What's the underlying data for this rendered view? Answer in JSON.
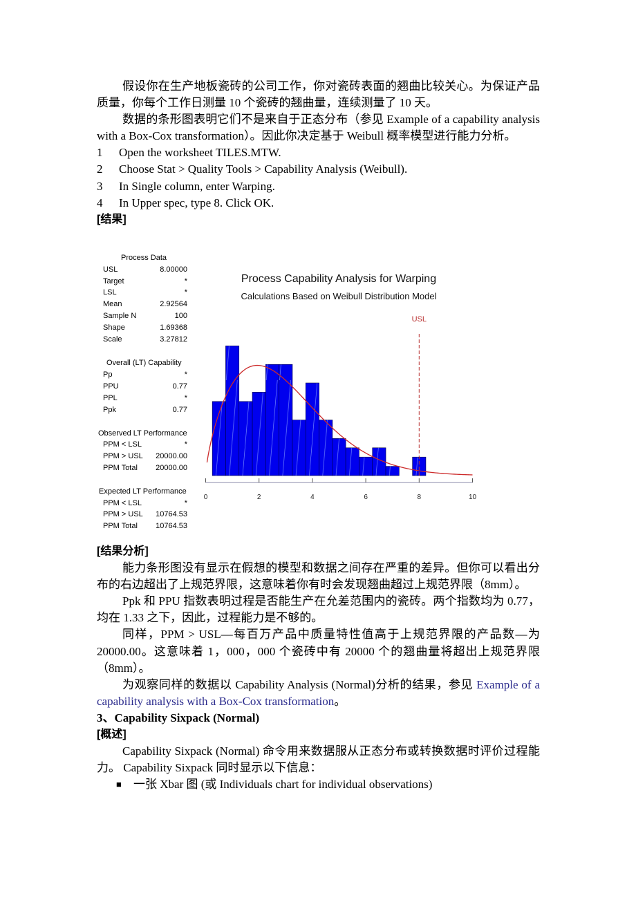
{
  "intro": {
    "p1": "假设你在生产地板瓷砖的公司工作，你对瓷砖表面的翘曲比较关心。为保证产品质量，你每个工作日测量 10 个瓷砖的翘曲量，连续测量了 10 天。",
    "p2": "数据的条形图表明它们不是来自于正态分布（参见 Example of a capability analysis with a Box-Cox transformation）。因此你决定基于 Weibull  概率模型进行能力分析。",
    "steps": [
      {
        "num": "1",
        "text": "Open the worksheet TILES.MTW."
      },
      {
        "num": "2",
        "text": "Choose Stat > Quality Tools > Capability Analysis (Weibull)."
      },
      {
        "num": "3",
        "text": "In Single column, enter Warping."
      },
      {
        "num": "4",
        "text": "In Upper spec, type 8. Click OK."
      }
    ],
    "results_heading": "[结果]"
  },
  "stats_panel": {
    "process_data": {
      "title": "Process Data",
      "rows": [
        {
          "label": "USL",
          "value": "8.00000"
        },
        {
          "label": "Target",
          "value": "*"
        },
        {
          "label": "LSL",
          "value": "*"
        },
        {
          "label": "Mean",
          "value": "2.92564"
        },
        {
          "label": "Sample N",
          "value": "100"
        },
        {
          "label": "Shape",
          "value": "1.69368"
        },
        {
          "label": "Scale",
          "value": "3.27812"
        }
      ]
    },
    "overall_capability": {
      "title": "Overall (LT) Capability",
      "rows": [
        {
          "label": "Pp",
          "value": "*"
        },
        {
          "label": "PPU",
          "value": "0.77"
        },
        {
          "label": "PPL",
          "value": "*"
        },
        {
          "label": "Ppk",
          "value": "0.77"
        }
      ]
    },
    "observed_performance": {
      "title": "Observed LT Performance",
      "rows": [
        {
          "label": "PPM < LSL",
          "value": "*"
        },
        {
          "label": "PPM > USL",
          "value": "20000.00"
        },
        {
          "label": "PPM Total",
          "value": "20000.00"
        }
      ]
    },
    "expected_performance": {
      "title": "Expected LT Performance",
      "rows": [
        {
          "label": "PPM < LSL",
          "value": "*"
        },
        {
          "label": "PPM > USL",
          "value": "10764.53"
        },
        {
          "label": "PPM Total",
          "value": "10764.53"
        }
      ]
    }
  },
  "chart_data": {
    "type": "bar",
    "subtype": "histogram-with-fitted-curve",
    "title": "Process Capability Analysis for Warping",
    "subtitle": "Calculations Based on Weibull Distribution Model",
    "xlabel": "",
    "ylabel": "",
    "xlim": [
      0,
      10
    ],
    "ylim": [
      0,
      15
    ],
    "x_ticks": [
      0,
      2,
      4,
      6,
      8,
      10
    ],
    "x_tick_labels": [
      "0",
      "2",
      "4",
      "6",
      "8",
      "10"
    ],
    "grid": false,
    "bin_width": 0.5,
    "categories": [
      0.5,
      1.0,
      1.5,
      2.0,
      2.5,
      3.0,
      3.5,
      4.0,
      4.5,
      5.0,
      5.5,
      6.0,
      6.5,
      7.0,
      7.5,
      8.0
    ],
    "values": [
      8,
      14,
      8,
      9,
      12,
      12,
      6,
      10,
      6,
      4,
      3,
      2,
      3,
      1,
      0,
      2
    ],
    "fitted_curve": {
      "distribution": "Weibull",
      "shape": 1.69368,
      "scale": 3.27812,
      "n": 100,
      "x_range": [
        0.05,
        10
      ]
    },
    "spec_lines": [
      {
        "label": "USL",
        "value": 8
      }
    ],
    "colors": {
      "bars": "#0000ee",
      "curve": "#cc2a2a",
      "usl": "#b83030",
      "axis": "#8a8aaa"
    }
  },
  "analysis": {
    "heading": "[结果分析]",
    "p1": "能力条形图没有显示在假想的模型和数据之间存在严重的差异。但你可以看出分布的右边超出了上规范界限，这意味着你有时会发现翘曲超过上规范界限（8mm）。",
    "p2": "Ppk 和 PPU  指数表明过程是否能生产在允差范围内的瓷砖。两个指数均为 0.77，均在 1.33 之下，因此，过程能力是不够的。",
    "p3": "同样，PPM > USL—每百万产品中质量特性值高于上规范界限的产品数—为 20000.00。这意味着 1，000，000 个瓷砖中有 20000 个的翘曲量将超出上规范界限（8mm）。",
    "p4_prefix": "为观察同样的数据以 Capability Analysis (Normal)分析的结果，参见 ",
    "p4_link": "Example of a capability analysis with a Box-Cox transformation",
    "p4_suffix": "。"
  },
  "section3": {
    "heading": "3、Capability Sixpack (Normal)",
    "overview_heading": "[概述]",
    "p1": "Capability Sixpack (Normal)  命令用来数据服从正态分布或转换数据时评价过程能力。 Capability Sixpack 同时显示以下信息：",
    "bullets": [
      "一张 Xbar 图  (或 Individuals chart for individual observations)"
    ]
  }
}
